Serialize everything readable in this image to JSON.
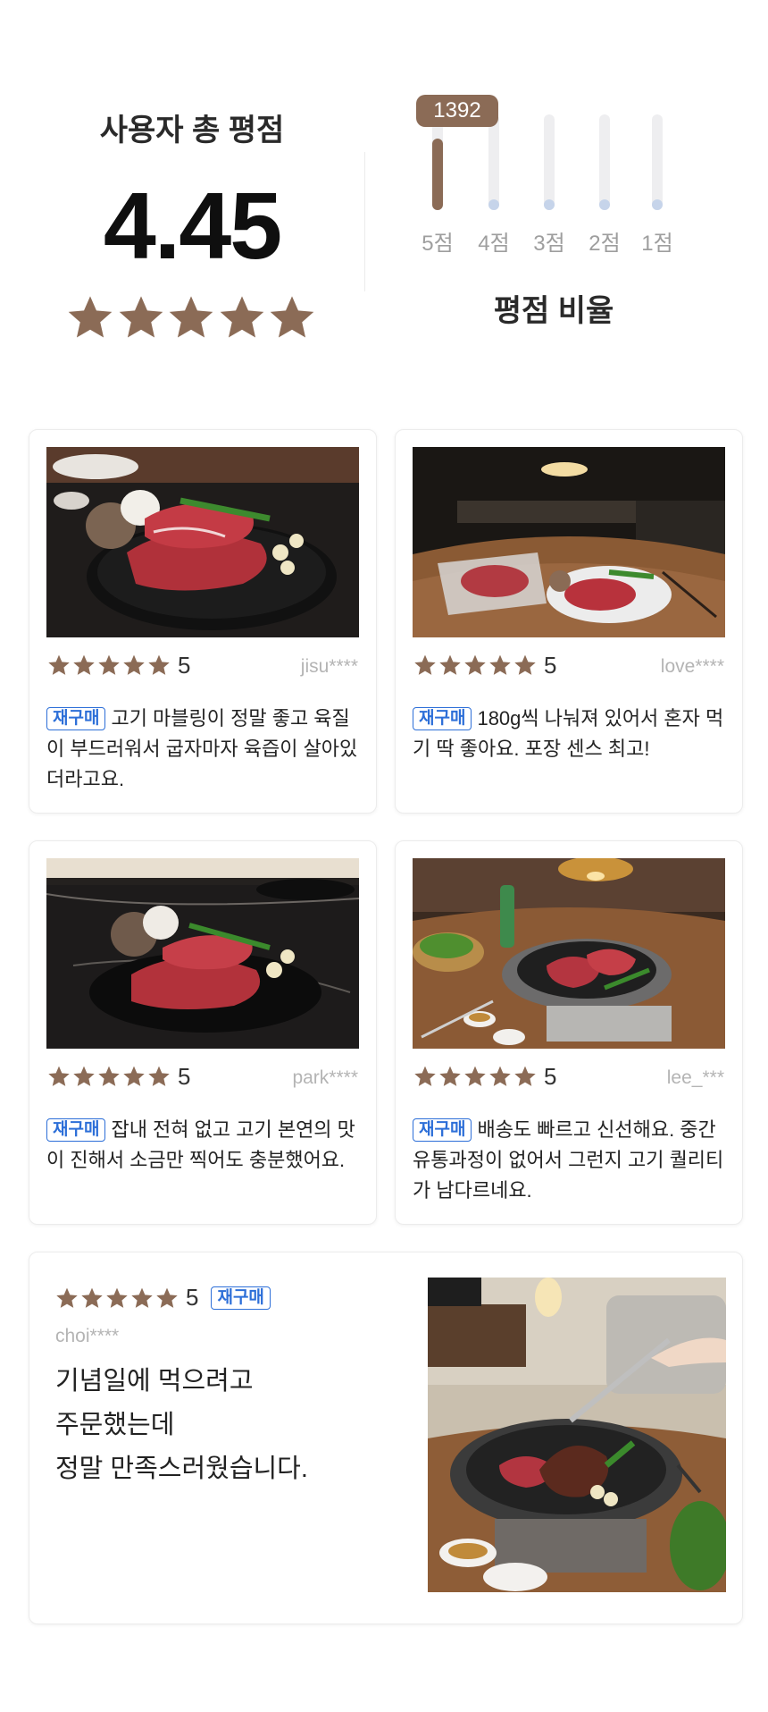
{
  "summary": {
    "total_title": "사용자 총 평점",
    "total_score": "4.45",
    "star_count": 5,
    "ratio_title": "평점 비율",
    "top_count": "1392",
    "distribution": [
      {
        "label": "5점",
        "fill": 0.75
      },
      {
        "label": "4점",
        "fill": 0.0
      },
      {
        "label": "3점",
        "fill": 0.0
      },
      {
        "label": "2점",
        "fill": 0.0
      },
      {
        "label": "1점",
        "fill": 0.0
      }
    ]
  },
  "colors": {
    "accent": "#8b6b56",
    "badge_blue": "#2d6fd8",
    "track": "#eeeef0",
    "dot": "#c6d4ea"
  },
  "reviews": [
    {
      "score": "5",
      "user": "jisu****",
      "badge": "재구매",
      "text": "고기 마블링이 정말 좋고 육질이 부드러워서 굽자마자 육즙이 살아있더라고요.",
      "photo": "steak-plate-on-marble-counter"
    },
    {
      "score": "5",
      "user": "love****",
      "badge": "재구매",
      "text": "180g씩 나눠져 있어서 혼자 먹기 딱 좋아요. 포장 센스 최고!",
      "photo": "steak-on-dining-table"
    },
    {
      "score": "5",
      "user": "park****",
      "badge": "재구매",
      "text": "잡내 전혀 없고 고기 본연의 맛이 진해서 소금만 찍어도 충분했어요.",
      "photo": "steak-plate-on-black-marble"
    },
    {
      "score": "5",
      "user": "lee_***",
      "badge": "재구매",
      "text": "배송도 빠르고 신선해요. 중간 유통과정이 없어서 그런지 고기 퀄리티가 남다르네요.",
      "photo": "steak-on-grill-pan-with-soju"
    }
  ],
  "featured_review": {
    "score": "5",
    "badge": "재구매",
    "user": "choi****",
    "lines": [
      "기념일에 먹으려고",
      "주문했는데",
      "정말 만족스러웠습니다."
    ],
    "photo": "steak-grilling-in-living-room"
  }
}
